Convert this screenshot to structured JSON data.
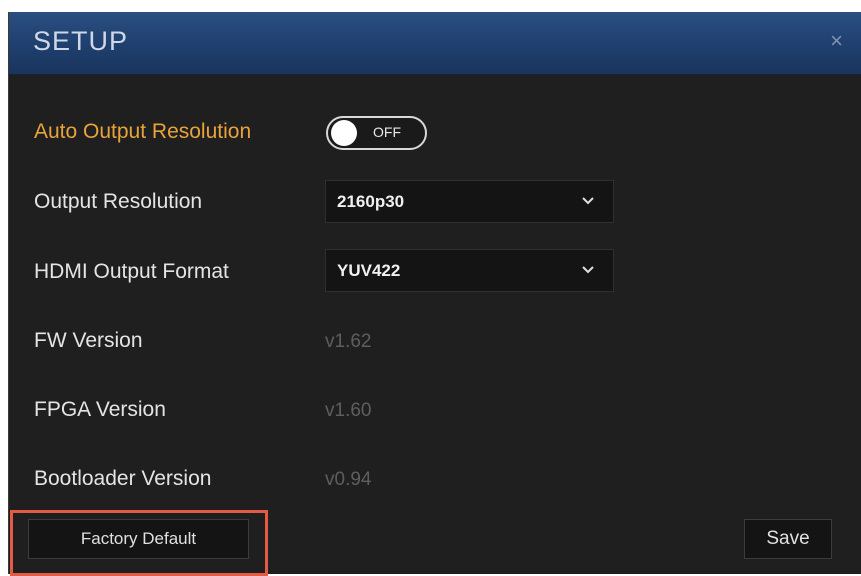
{
  "dialog": {
    "title": "SETUP",
    "close_glyph": "×"
  },
  "auto_output_resolution": {
    "label": "Auto Output Resolution",
    "toggle_state": "OFF",
    "enabled": false
  },
  "output_resolution": {
    "label": "Output Resolution",
    "selected": "2160p30"
  },
  "hdmi_output_format": {
    "label": "HDMI Output Format",
    "selected": "YUV422"
  },
  "fw_version": {
    "label": "FW Version",
    "value": "v1.62"
  },
  "fpga_version": {
    "label": "FPGA Version",
    "value": "v1.60"
  },
  "bootloader_version": {
    "label": "Bootloader Version",
    "value": "v0.94"
  },
  "buttons": {
    "factory_default": "Factory Default",
    "save": "Save"
  },
  "colors": {
    "title_bar": "#1f3f6e",
    "accent_label": "#e8a33a",
    "highlight_box": "#e35b45",
    "dialog_background": "#1f1f1f"
  },
  "icons": {
    "close": "close-icon",
    "dropdown": "chevron-down-icon"
  }
}
